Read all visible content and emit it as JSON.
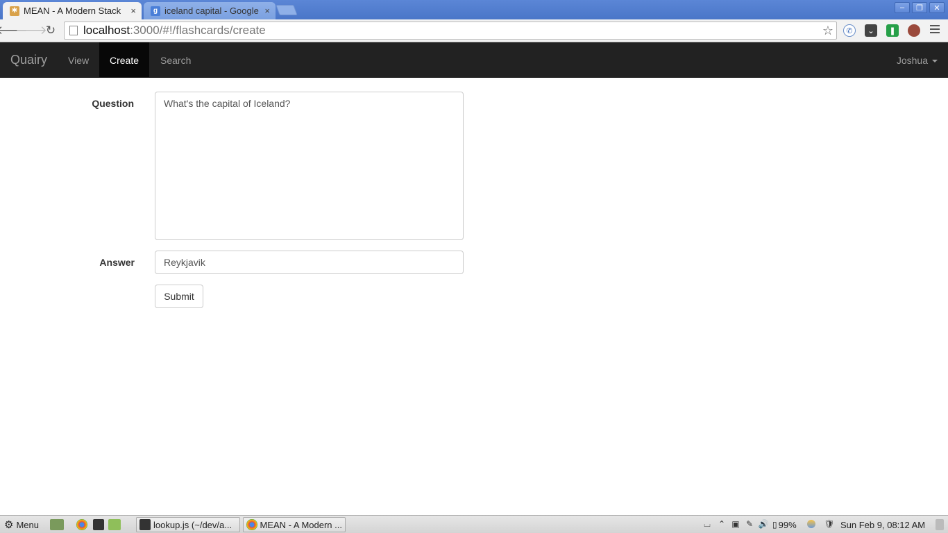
{
  "browser": {
    "tabs": [
      {
        "title": "MEAN - A Modern Stack",
        "close": "×",
        "active": true
      },
      {
        "title": "iceland capital - Google",
        "close": "×",
        "active": false
      }
    ],
    "url_host": "localhost",
    "url_rest": ":3000/#!/flashcards/create",
    "window_controls": [
      "–",
      "❐",
      "✕"
    ]
  },
  "app": {
    "brand": "Quairy",
    "nav": [
      {
        "label": "View",
        "active": false
      },
      {
        "label": "Create",
        "active": true
      },
      {
        "label": "Search",
        "active": false
      }
    ],
    "user": "Joshua"
  },
  "form": {
    "question_label": "Question",
    "question_value": "What's the capital of Iceland?",
    "answer_label": "Answer",
    "answer_value": "Reykjavik",
    "submit_label": "Submit"
  },
  "taskbar": {
    "menu_label": "Menu",
    "windows": [
      "lookup.js (~/dev/a...",
      "MEAN - A Modern ..."
    ],
    "battery": "99%",
    "clock": "Sun Feb  9, 08:12 AM"
  },
  "colors": {
    "navbar_bg": "#222222",
    "navbar_active_bg": "#080808",
    "tab_strip": "#4a76c8"
  }
}
